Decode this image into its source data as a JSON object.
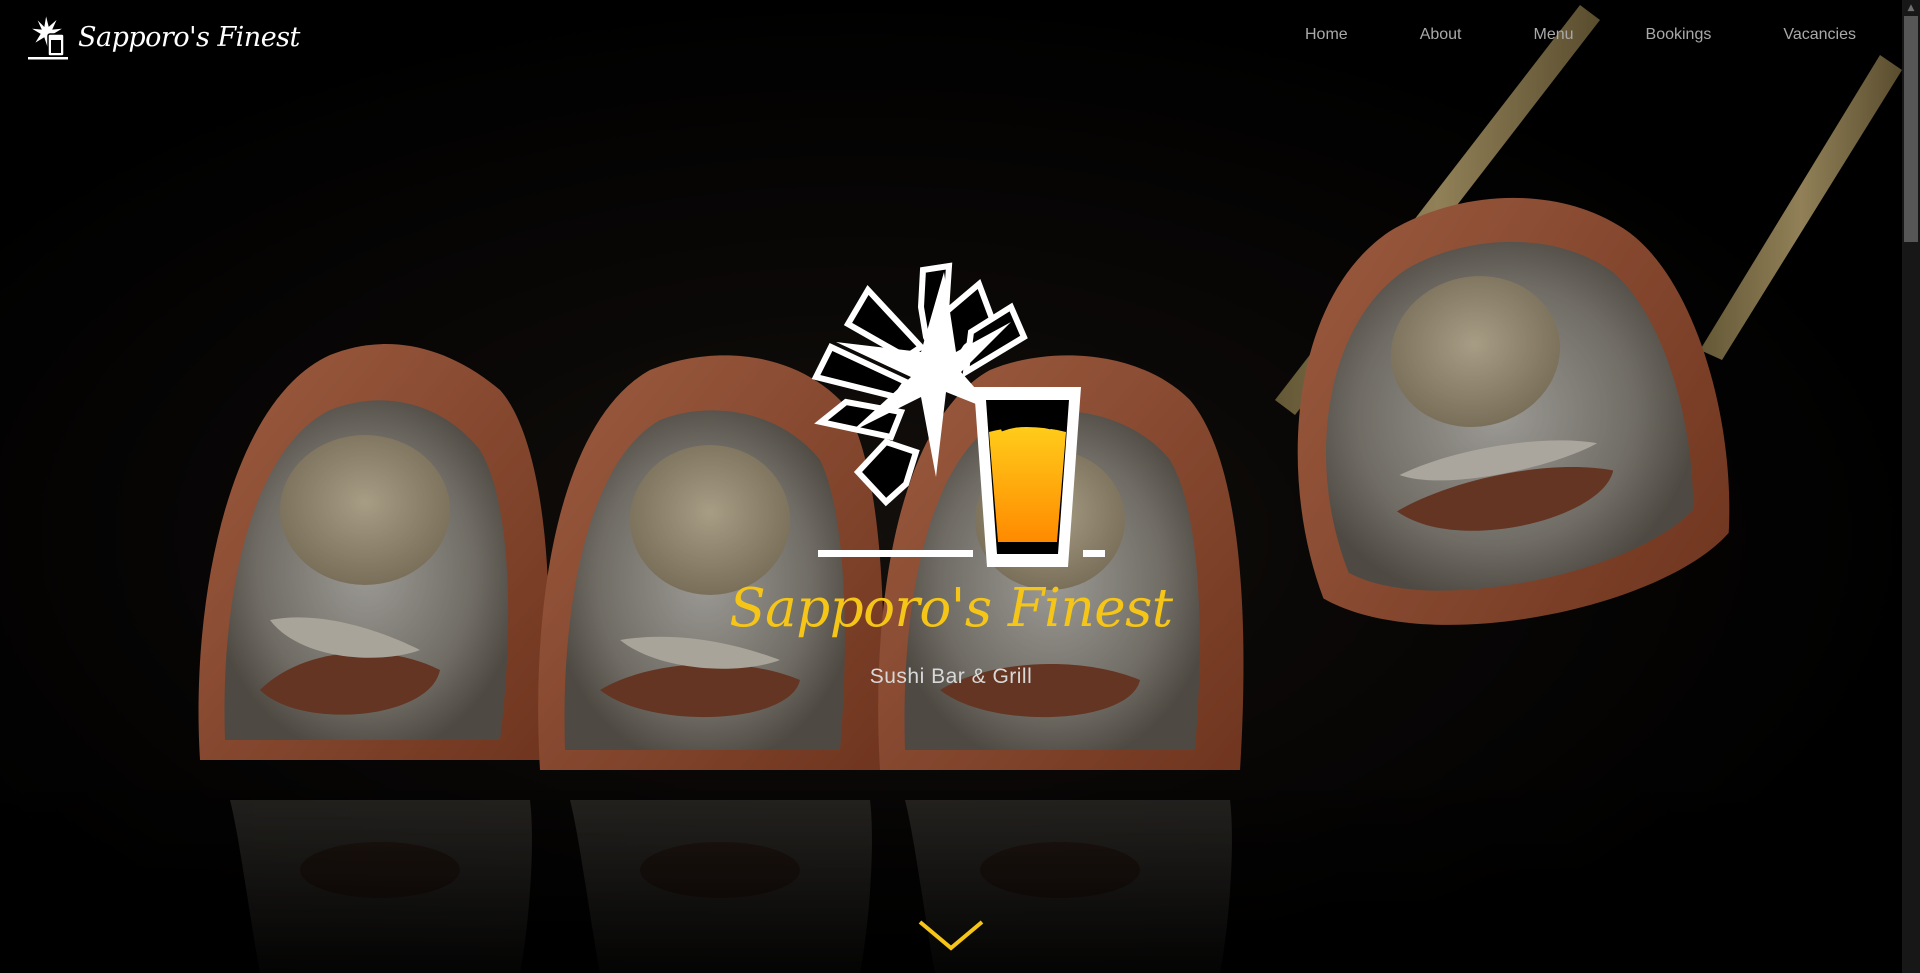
{
  "brand": {
    "name": "Sapporo's Finest",
    "logo_icon": "star-and-glass-logo"
  },
  "nav": {
    "items": [
      {
        "label": "Home"
      },
      {
        "label": "About"
      },
      {
        "label": "Menu"
      },
      {
        "label": "Bookings"
      },
      {
        "label": "Vacancies"
      }
    ]
  },
  "hero": {
    "title": "Sapporo's Finest",
    "subtitle": "Sushi Bar & Grill",
    "background": "sushi-rolls-with-chopsticks-photo",
    "scroll_icon": "chevron-down-icon"
  },
  "colors": {
    "accent": "#f5c518",
    "glass_top": "#ffcc1a",
    "glass_bottom": "#ff8a00",
    "nav_text": "#a9a9a9",
    "background": "#000000"
  }
}
